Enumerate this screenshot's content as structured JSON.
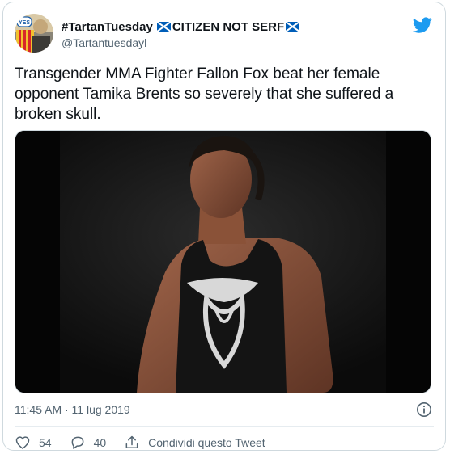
{
  "user": {
    "display_name": "#TartanTuesday",
    "display_name_suffix": "CITIZEN NOT SERF",
    "handle": "@Tartantuesdayl",
    "avatar_badge": "YES"
  },
  "tweet": {
    "text": "Transgender MMA Fighter Fallon Fox beat her female opponent Tamika Brents so severely that she suffered a broken skull.",
    "timestamp": "11:45 AM · 11 lug 2019"
  },
  "actions": {
    "likes": "54",
    "replies": "40",
    "share_label": "Condividi questo Tweet"
  },
  "colors": {
    "twitter_blue": "#1d9bf0",
    "text_secondary": "#536471",
    "saltire_blue": "#005eb8"
  },
  "icons": [
    "twitter-bird-icon",
    "scottish-flag-icon",
    "info-icon",
    "heart-icon",
    "reply-icon",
    "share-icon"
  ]
}
